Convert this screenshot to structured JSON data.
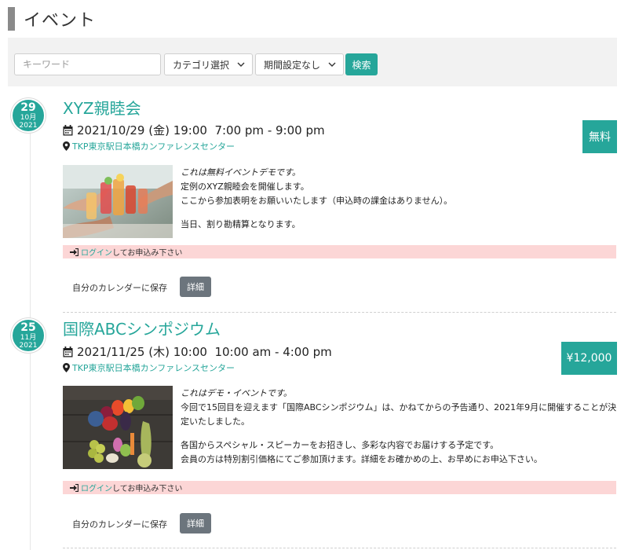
{
  "page": {
    "title": "イベント"
  },
  "search": {
    "keyword_placeholder": "キーワード",
    "category_label": "カテゴリ選択",
    "period_label": "期間設定なし",
    "button_label": "検索"
  },
  "events": [
    {
      "day": "29",
      "month": "10月",
      "year": "2021",
      "title": "XYZ親睦会",
      "datetime": "2021/10/29 (金) 19:00  7:00 pm - 9:00 pm",
      "venue": "TKP東京駅日本橋カンファレンスセンター",
      "price": "無料",
      "lead": "これは無料イベントデモです。",
      "lines": [
        "定例のXYZ親睦会を開催します。",
        "ここから参加表明をお願いいたします（申込時の課金はありません）。"
      ],
      "lines2": [
        "当日、割り勘精算となります。"
      ],
      "login_link": "ログイン",
      "login_text": "してお申込み下さい",
      "save_calendar": "自分のカレンダーに保存",
      "detail_label": "詳細"
    },
    {
      "day": "25",
      "month": "11月",
      "year": "2021",
      "title": "国際ABCシンポジウム",
      "datetime": "2021/11/25 (木) 10:00  10:00 am - 4:00 pm",
      "venue": "TKP東京駅日本橋カンファレンスセンター",
      "price": "¥12,000",
      "lead": "これはデモ・イベントです。",
      "lines": [
        "今回で15回目を迎えます「国際ABCシンポジウム」は、かねてからの予告通り、2021年9月に開催することが決定いたしました。"
      ],
      "lines2": [
        "各国からスペシャル・スピーカーをお招きし、多彩な内容でお届けする予定です。",
        "会員の方は特別割引価格にてご参加頂けます。詳細をお確かめの上、お早めにお申込下さい。"
      ],
      "login_link": "ログイン",
      "login_text": "してお申込み下さい",
      "save_calendar": "自分のカレンダーに保存",
      "detail_label": "詳細"
    }
  ],
  "colors": {
    "accent": "#26a69a",
    "login_bar": "#fcd6d6",
    "detail_button": "#6c757d",
    "search_panel": "#f2f2f2"
  },
  "icons": {
    "dropdown": "chevron-down-icon",
    "date": "calendar-icon",
    "venue": "map-marker-icon",
    "login": "sign-in-icon"
  }
}
